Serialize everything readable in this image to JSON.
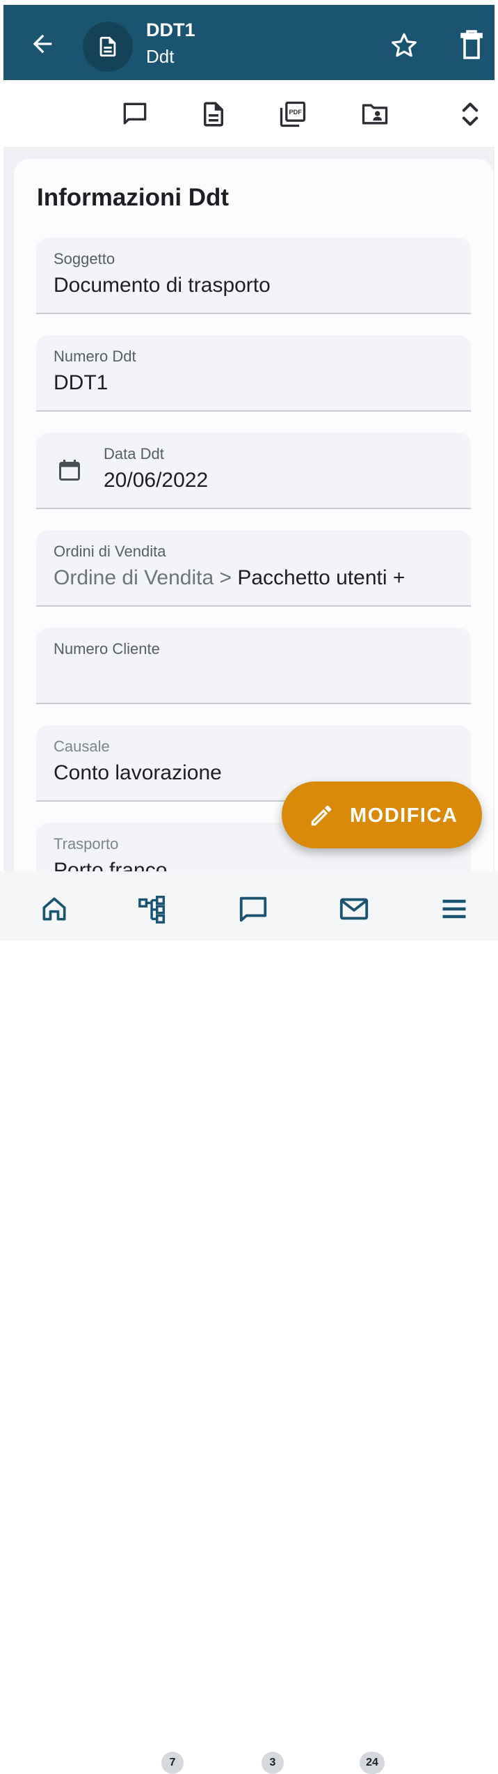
{
  "header": {
    "title": "DDT1",
    "subtitle": "Ddt",
    "icons": [
      "back-arrow-icon",
      "document-icon",
      "star-icon",
      "trash-icon"
    ]
  },
  "toolbar": {
    "icons": [
      "comment-icon",
      "document-icon",
      "pdf-icon",
      "folder-contact-icon",
      "expand-icon"
    ]
  },
  "card": {
    "title": "Informazioni Ddt",
    "fields": [
      {
        "label": "Soggetto",
        "value": "Documento di trasporto"
      },
      {
        "label": "Numero Ddt",
        "value": "DDT1"
      },
      {
        "label": "Data Ddt",
        "value": "20/06/2022",
        "icon": "calendar-icon"
      },
      {
        "label": "Ordini di Vendita",
        "value_prefix": "Ordine di Vendita >",
        "value": "Pacchetto utenti +"
      },
      {
        "label": "Numero Cliente",
        "value": ""
      },
      {
        "label": "Causale",
        "value": "Conto lavorazione"
      },
      {
        "label": "Trasporto",
        "value": "Porto franco"
      }
    ]
  },
  "fab": {
    "label": "MODIFICA",
    "icon": "pencil-icon"
  },
  "bottom_nav": {
    "items": [
      {
        "name": "home",
        "icon": "home-icon",
        "badge": ""
      },
      {
        "name": "hierarchy",
        "icon": "hierarchy-icon",
        "badge": "7"
      },
      {
        "name": "comments",
        "icon": "comment-icon",
        "badge": "3"
      },
      {
        "name": "mail",
        "icon": "mail-icon",
        "badge": "24"
      },
      {
        "name": "menu",
        "icon": "menu-icon",
        "badge": ""
      }
    ]
  },
  "colors": {
    "primary": "#1b5470",
    "accent": "#d98a08"
  }
}
